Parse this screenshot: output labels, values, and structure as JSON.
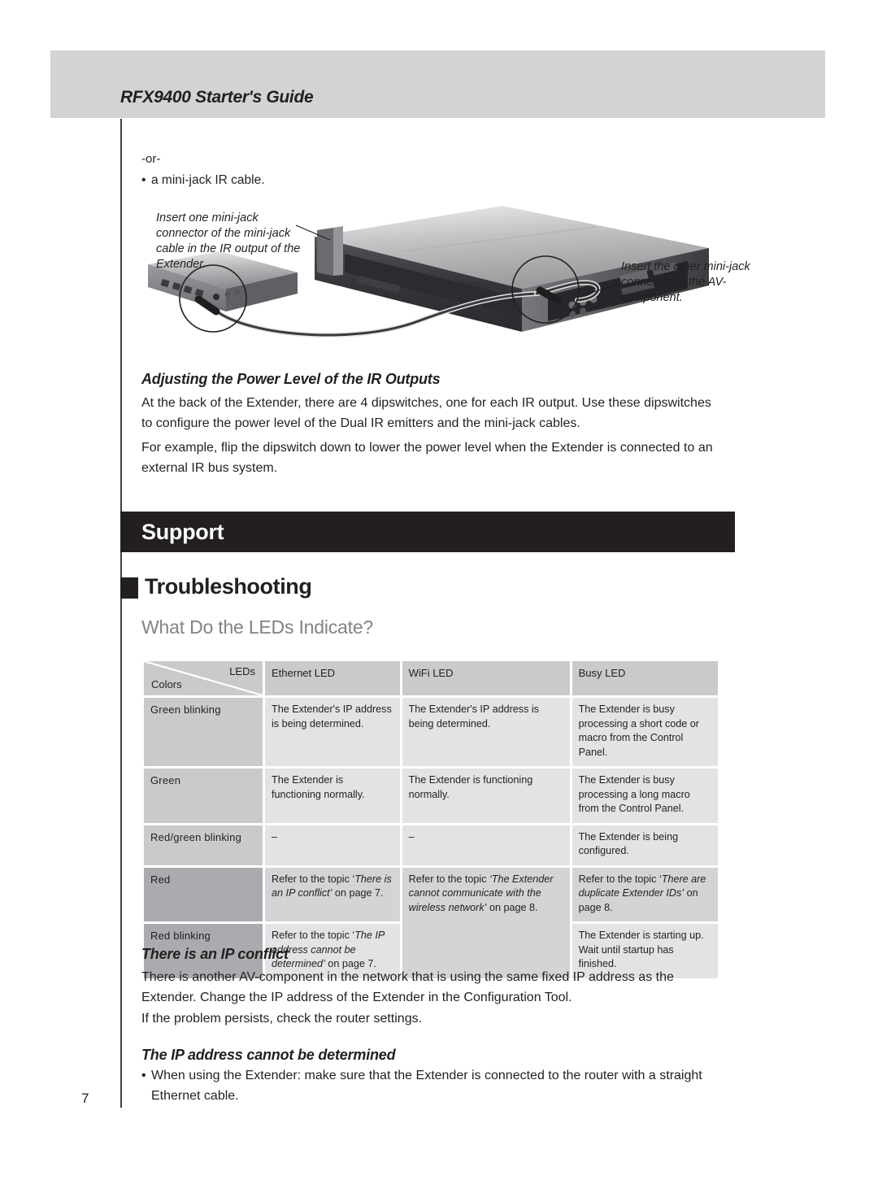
{
  "document": {
    "header_title": "RFX9400 Starter's Guide",
    "page_number": "7"
  },
  "intro": {
    "or_label": "-or-",
    "bullet": "a mini-jack IR cable."
  },
  "illustration": {
    "callout_left": "Insert one mini-jack connector of the mini-jack cable in the IR output of the Extender.",
    "callout_right": "Insert the other mini-jack connector in the AV-component."
  },
  "power_section": {
    "heading": "Adjusting the Power Level of the IR Outputs",
    "paragraph1": "At the back of the Extender, there are 4 dipswitches, one for each IR output. Use these dipswitches to configure the power level of the Dual IR emitters and the mini-jack cables.",
    "paragraph2": "For example, flip the dipswitch down to lower the power level when the Extender is connected to an external IR bus system."
  },
  "support": {
    "banner_title": "Support",
    "troubleshooting_title": "Troubleshooting",
    "leds_question": "What Do the LEDs Indicate?"
  },
  "led_table": {
    "corner_top": "LEDs",
    "corner_bottom": "Colors",
    "columns": [
      "Ethernet LED",
      "WiFi LED",
      "Busy LED"
    ],
    "rows": [
      {
        "color": "Green blinking",
        "ethernet": "The Extender's IP address is being determined.",
        "wifi": "The Extender's IP address is being determined.",
        "busy": "The Extender is busy processing a short code or macro from the Control Panel."
      },
      {
        "color": "Green",
        "ethernet": "The Extender is functioning normally.",
        "wifi": "The Extender is functioning normally.",
        "busy": "The Extender is busy processing a long macro from the Control Panel."
      },
      {
        "color": "Red/green blinking",
        "ethernet": "–",
        "wifi": "–",
        "busy": "The Extender is being configured."
      },
      {
        "color": "Red",
        "ethernet_prefix": "Refer to the topic ‘",
        "ethernet_italic": "There is an IP conflict’",
        "ethernet_suffix": " on page 7.",
        "wifi_prefix": "Refer to the topic ",
        "wifi_italic": "‘The Extender cannot communicate with the wireless network’",
        "wifi_suffix": " on page 8.",
        "busy_prefix": "Refer to the topic ‘",
        "busy_italic": "There are duplicate Extender IDs’",
        "busy_suffix": " on page 8."
      },
      {
        "color": "Red blinking",
        "ethernet_prefix": "Refer to the topic ‘",
        "ethernet_italic": "The IP address cannot be determined’",
        "ethernet_suffix": " on page 7.",
        "busy": "The Extender is starting up. Wait until startup has finished."
      }
    ]
  },
  "ip_conflict": {
    "heading": "There is an IP conflict",
    "paragraph1": "There is another AV-component in the network that is using the same fixed IP address as the Extender. Change the IP address of the Extender in the Configuration Tool.",
    "paragraph2": "If the problem persists, check the router settings."
  },
  "ip_undetermined": {
    "heading": "The IP address cannot be determined",
    "bullet1": "When using the Extender: make sure that the Extender is connected to the router with a straight Ethernet cable."
  },
  "colors": {
    "header_band": "#d2d3d5",
    "banner_dark": "#231f20",
    "table_header": "#c9cacc",
    "table_cell": "#e2e3e5",
    "heading_gray": "#808387"
  }
}
